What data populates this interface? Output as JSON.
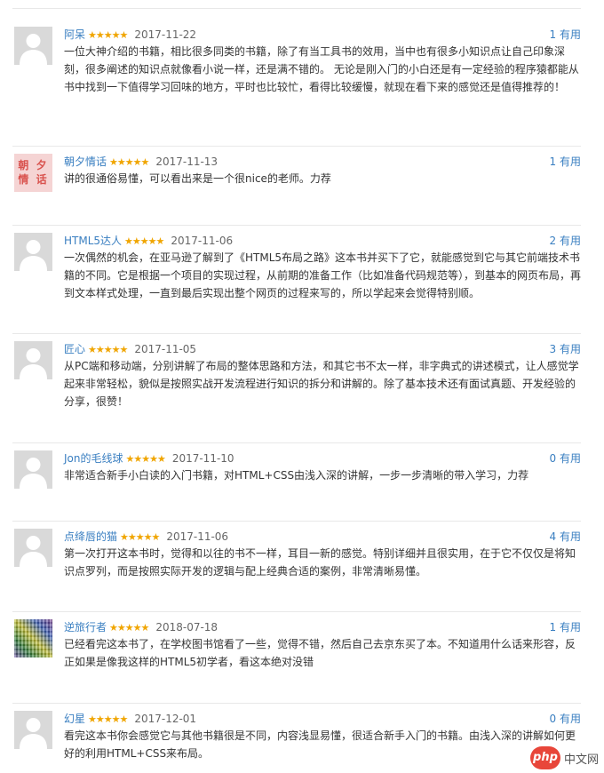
{
  "reviews": [
    {
      "user": "阿呆",
      "stars": "★★★★★",
      "date": "2017-11-22",
      "useful": "1 有用",
      "avatar": "default",
      "text": "一位大神介绍的书籍，相比很多同类的书籍，除了有当工具书的效用，当中也有很多小知识点让自己印象深刻，很多阐述的知识点就像看小说一样，还是满不错的。 无论是刚入门的小白还是有一定经验的程序猿都能从书中找到一下值得学习回味的地方，平时也比较忙，看得比较缓慢，就现在看下来的感觉还是值得推荐的！"
    },
    {
      "user": "朝夕情话",
      "stars": "★★★★★",
      "date": "2017-11-13",
      "useful": "1 有用",
      "avatar": "text",
      "avatar_text": "朝 夕\n情 话",
      "text": "讲的很通俗易懂，可以看出来是一个很nice的老师。力荐"
    },
    {
      "user": "HTML5达人",
      "stars": "★★★★★",
      "date": "2017-11-06",
      "useful": "2 有用",
      "avatar": "default",
      "text": "一次偶然的机会，在亚马逊了解到了《HTML5布局之路》这本书并买下了它，就能感觉到它与其它前端技术书籍的不同。它是根据一个项目的实现过程，从前期的准备工作（比如准备代码规范等），到基本的网页布局，再到文本样式处理，一直到最后实现出整个网页的过程来写的，所以学起来会觉得特别顺。"
    },
    {
      "user": "匠心",
      "stars": "★★★★★",
      "date": "2017-11-05",
      "useful": "3 有用",
      "avatar": "default",
      "text": "从PC端和移动端，分别讲解了布局的整体思路和方法，和其它书不太一样，非字典式的讲述模式，让人感觉学起来非常轻松，貌似是按照实战开发流程进行知识的拆分和讲解的。除了基本技术还有面试真题、开发经验的分享，很赞！"
    },
    {
      "user": "Jon的毛线球",
      "stars": "★★★★★",
      "date": "2017-11-10",
      "useful": "0 有用",
      "avatar": "default",
      "text": "非常适合新手小白读的入门书籍，对HTML+CSS由浅入深的讲解，一步一步清晰的带入学习，力荐"
    },
    {
      "user": "点绛唇的猫",
      "stars": "★★★★★",
      "date": "2017-11-06",
      "useful": "4 有用",
      "avatar": "default",
      "text": "第一次打开这本书时，觉得和以往的书不一样，耳目一新的感觉。特别详细并且很实用，在于它不仅仅是将知识点罗列，而是按照实际开发的逻辑与配上经典合适的案例，非常清晰易懂。"
    },
    {
      "user": "逆旅行者",
      "stars": "★★★★★",
      "date": "2018-07-18",
      "useful": "1 有用",
      "avatar": "mosaic",
      "text": "已经看完这本书了，在学校图书馆看了一些，觉得不错，然后自己去京东买了本。不知道用什么话来形容，反正如果是像我这样的HTML5初学者，看这本绝对没错"
    },
    {
      "user": "幻星",
      "stars": "★★★★★",
      "date": "2017-12-01",
      "useful": "0 有用",
      "avatar": "default",
      "text": "看完这本书你会感觉它与其他书籍很是不同，内容浅显易懂，很适合新手入门的书籍。由浅入深的讲解如何更好的利用HTML+CSS来布局。"
    }
  ],
  "watermark": {
    "logo": "php",
    "text": "中文网"
  }
}
